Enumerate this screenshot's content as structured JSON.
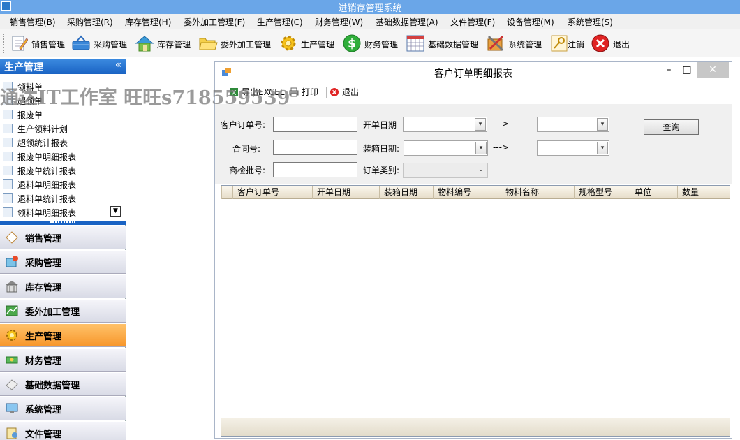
{
  "app": {
    "title": "进销存管理系统"
  },
  "menu": [
    "销售管理(B)",
    "采购管理(R)",
    "库存管理(H)",
    "委外加工管理(F)",
    "生产管理(C)",
    "财务管理(W)",
    "基础数据管理(A)",
    "文件管理(F)",
    "设备管理(M)",
    "系统管理(S)"
  ],
  "toolbar": {
    "items": [
      {
        "label": "销售管理",
        "icon": "pencil-icon"
      },
      {
        "label": "采购管理",
        "icon": "basket-icon"
      },
      {
        "label": "库存管理",
        "icon": "house-icon"
      },
      {
        "label": "委外加工管理",
        "icon": "folder-icon"
      },
      {
        "label": "生产管理",
        "icon": "gear-icon"
      },
      {
        "label": "财务管理",
        "icon": "dollar-icon"
      },
      {
        "label": "基础数据管理",
        "icon": "calendar-icon"
      },
      {
        "label": "系统管理",
        "icon": "tools-icon"
      },
      {
        "label": "注销",
        "icon": "key-icon"
      },
      {
        "label": "退出",
        "icon": "exit-icon"
      }
    ]
  },
  "sidebar": {
    "header": "生产管理",
    "collapse_glyph": "«",
    "items": [
      "领料单",
      "超领单",
      "报废单",
      "生产领料计划",
      "超领统计报表",
      "报废单明细报表",
      "报废单统计报表",
      "退料单明细报表",
      "退料单统计报表",
      "领料单明细报表"
    ],
    "scroll_glyph": "▼",
    "nav": [
      {
        "label": "销售管理",
        "active": false
      },
      {
        "label": "采购管理",
        "active": false
      },
      {
        "label": "库存管理",
        "active": false
      },
      {
        "label": "委外加工管理",
        "active": false
      },
      {
        "label": "生产管理",
        "active": true
      },
      {
        "label": "财务管理",
        "active": false
      },
      {
        "label": "基础数据管理",
        "active": false
      },
      {
        "label": "系统管理",
        "active": false
      },
      {
        "label": "文件管理",
        "active": false
      }
    ]
  },
  "watermark": "通达IT工作室 旺旺s718559539",
  "report": {
    "title": "客户订单明细报表",
    "win_min": "–",
    "win_max": "□",
    "win_close": "✕",
    "tools": {
      "export": "导出EXCEL",
      "print": "打印",
      "exit": "退出"
    },
    "form": {
      "order_no_label": "客户订单号:",
      "order_date_label": "开单日期",
      "arrow1": "--->",
      "contract_label": "合同号:",
      "pack_date_label": "装箱日期:",
      "arrow2": "--->",
      "inspect_label": "商检批号:",
      "order_type_label": "订单类别:",
      "query_button": "查询",
      "combo_arrow": "▾",
      "combo_arrow_dis": "⌄"
    },
    "columns": [
      "客户订单号",
      "开单日期",
      "装箱日期",
      "物料编号",
      "物料名称",
      "规格型号",
      "单位",
      "数量"
    ]
  },
  "colors": {
    "titlebar": "#6aa6e8",
    "sidebar_header": "#1a63c4",
    "active_nav": "#f7962a"
  }
}
